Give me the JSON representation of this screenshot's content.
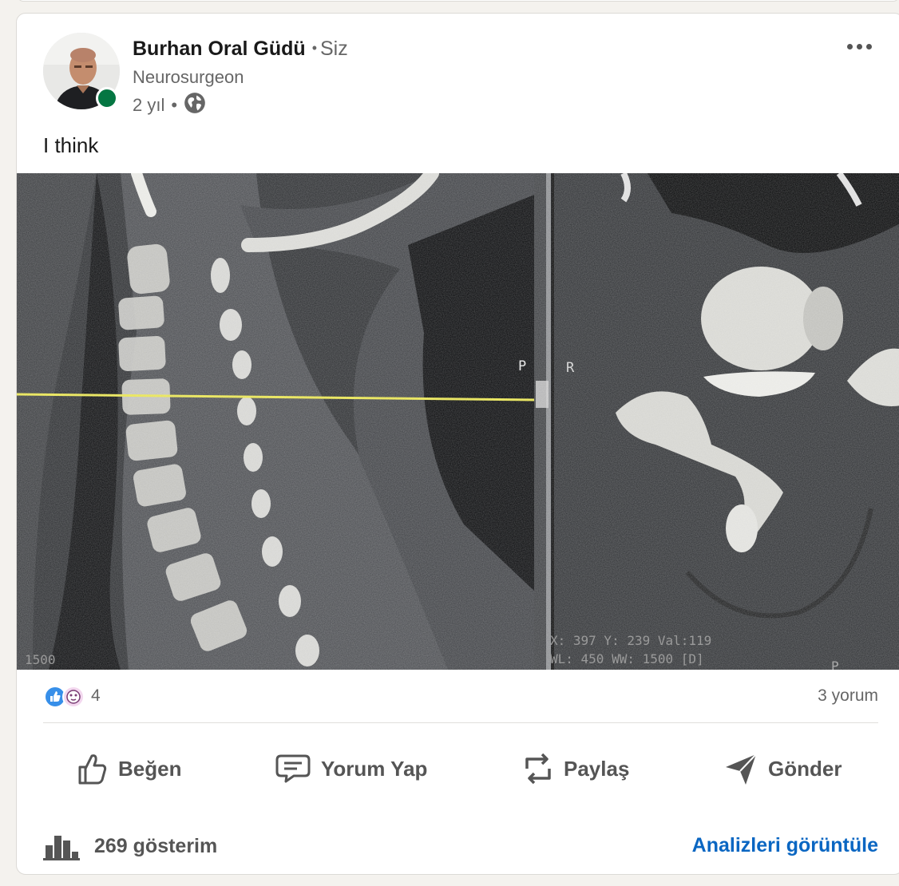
{
  "post": {
    "author_name": "Burhan Oral Güdü",
    "separator": "•",
    "connection_degree": "Siz",
    "author_headline": "Neurosurgeon",
    "posted_ago": "2 yıl",
    "meta_separator": "•",
    "visibility_icon": "globe-icon",
    "online_status_color": "#057642",
    "text": "I think"
  },
  "image": {
    "kind": "ct-scan-cervical-spine",
    "overlay": {
      "label_p_left": "P",
      "label_r": "R",
      "label_p_bottom": "P",
      "readout_line1": "X: 397 Y: 239 Val:119",
      "readout_line2": "WL: 450 WW: 1500 [D]",
      "left_window_value": "1500"
    }
  },
  "social": {
    "reaction_icons": [
      "like-icon",
      "insightful-icon"
    ],
    "reaction_count": "4",
    "comments_label": "3 yorum"
  },
  "actions": [
    {
      "label": "Beğen",
      "icon": "thumbs-up-icon"
    },
    {
      "label": "Yorum Yap",
      "icon": "comment-icon"
    },
    {
      "label": "Paylaş",
      "icon": "repost-icon"
    },
    {
      "label": "Gönder",
      "icon": "send-icon"
    }
  ],
  "footer": {
    "impressions_icon": "bar-chart-icon",
    "impressions_label": "269 gösterim",
    "analytics_link": "Analizleri görüntüle"
  },
  "colors": {
    "brand_link": "#0a66c2",
    "secondary_text": "#666666",
    "card_bg": "#ffffff",
    "page_bg": "#f4f2ee"
  }
}
